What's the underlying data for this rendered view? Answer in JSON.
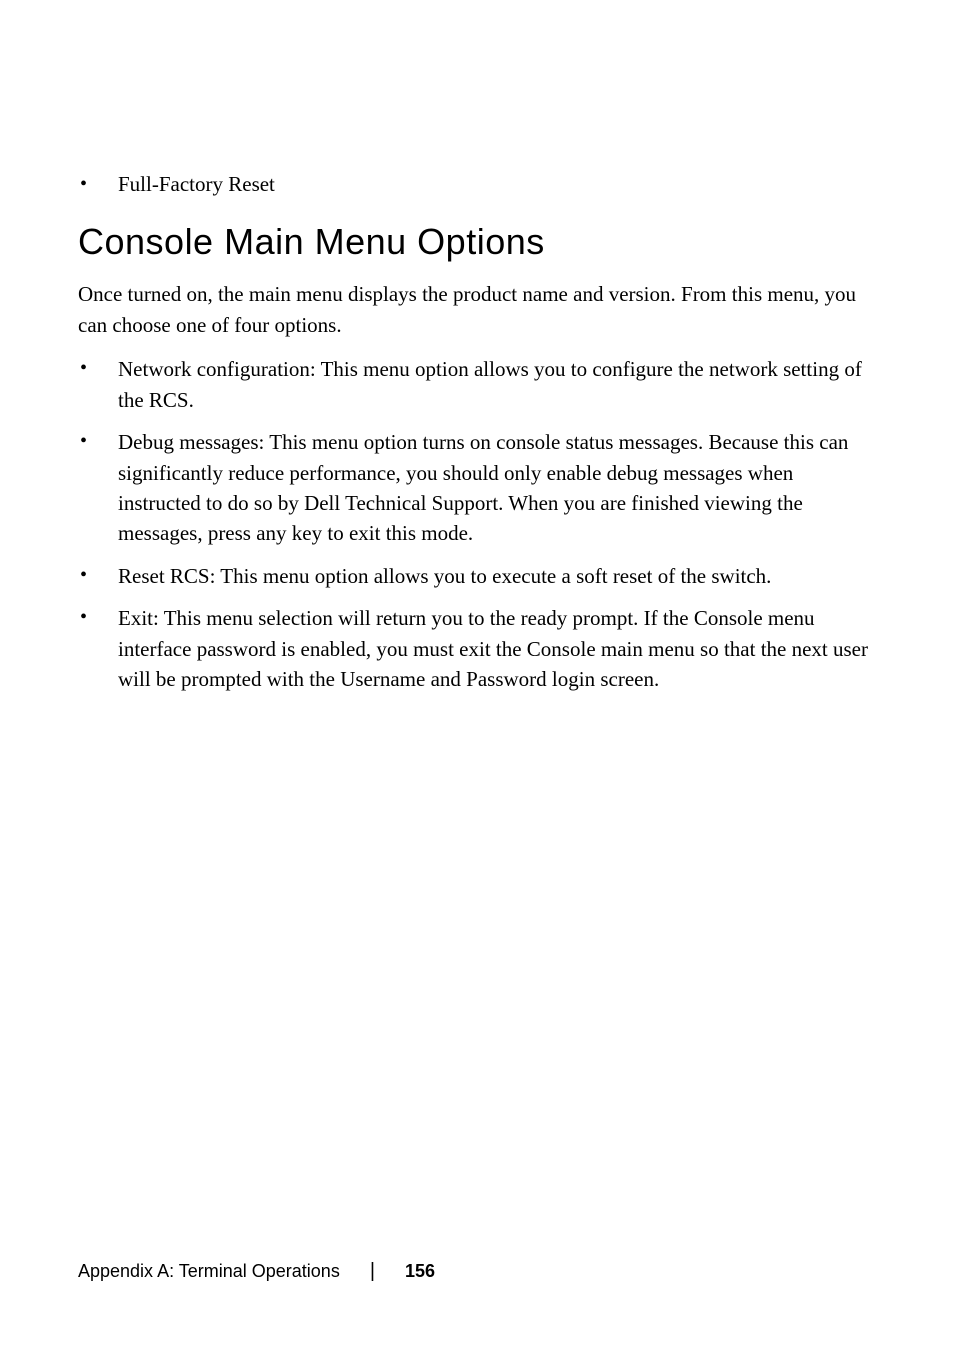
{
  "topBullet": "Full-Factory Reset",
  "heading": "Console Main Menu Options",
  "intro": "Once turned on, the main menu displays the product name and version. From this menu, you can choose one of four options.",
  "bullets": [
    "Network configuration: This menu option allows you to configure the network setting of the RCS.",
    "Debug messages: This menu option turns on console status messages. Because this can significantly reduce performance, you should only enable debug messages when instructed to do so by Dell Technical Support. When you are finished viewing the messages, press any key to exit this mode.",
    "Reset RCS: This menu option allows you to execute a soft reset of the switch.",
    "Exit: This menu selection will return you to the ready prompt. If the Console menu interface password is enabled, you must exit the Console main menu so that the next user will be prompted with the Username and Password login screen."
  ],
  "footer": {
    "label": "Appendix A: Terminal Operations",
    "page": "156"
  }
}
